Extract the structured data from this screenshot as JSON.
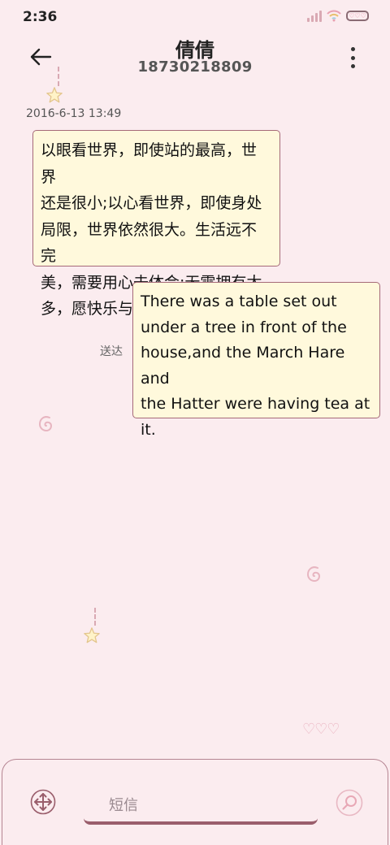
{
  "status_bar": {
    "time": "2:36",
    "battery_glyph": "♡♡♡",
    "icons": [
      "signal-icon",
      "wifi-icon",
      "battery-icon"
    ]
  },
  "header": {
    "title": "倩倩",
    "phone": "18730218809",
    "back_icon": "back-arrow-icon",
    "menu_icon": "more-vertical-icon"
  },
  "conversation": {
    "timestamp": "2016-6-13 13:49",
    "incoming": {
      "lines": [
        "以眼看世界，即使站的最高，世界",
        "还是很小;以心看世界，即使身处",
        "局限，世界依然很大。生活远不完",
        "美，需要用心去体会;无需拥有太",
        "多，愿快乐与你相随。"
      ]
    },
    "outgoing": {
      "lines": [
        "There was a table set out",
        "under a tree in front of the",
        "house,and the March Hare and",
        "the Hatter were having tea at",
        "it."
      ],
      "status": "送达"
    }
  },
  "input": {
    "placeholder": "短信",
    "left_icon": "move-arrows-icon",
    "right_icon": "search-icon"
  },
  "decorations": {
    "hearts": "♡♡♡"
  },
  "colors": {
    "background": "#fbecef",
    "bubble_fill": "#fff9dc",
    "bubble_border": "#a56a78",
    "accent": "#9a5e6c"
  }
}
